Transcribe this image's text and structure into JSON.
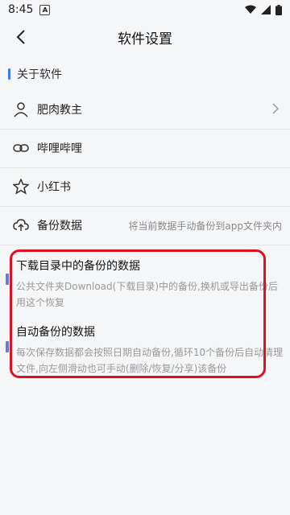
{
  "status": {
    "time": "8:45",
    "notif_icon": "A"
  },
  "header": {
    "title": "软件设置",
    "back_icon": "chevron-left-icon"
  },
  "section": {
    "title": "关于软件",
    "accent": "#3a7afe"
  },
  "items": [
    {
      "label": "肥肉教主",
      "icon": "user-icon"
    },
    {
      "label": "哔哩哔哩",
      "icon": "link-icon"
    },
    {
      "label": "小红书",
      "icon": "star-icon"
    },
    {
      "label": "备份数据",
      "icon": "cloud-upload-icon",
      "desc": "将当前数据手动备份到app文件夹内"
    }
  ],
  "backups": [
    {
      "title": "下载目录中的备份的数据",
      "desc": "公共文件夹Download(下载目录)中的备份,换机或导出备份后用这个恢复"
    },
    {
      "title": "自动备份的数据",
      "desc": "每次保存数据都会按照日期自动备份,循环10个备份后自动清理文件,向左侧滑动也可手动(删除/恢复/分享)该备份"
    }
  ],
  "highlight_color": "#e01020"
}
